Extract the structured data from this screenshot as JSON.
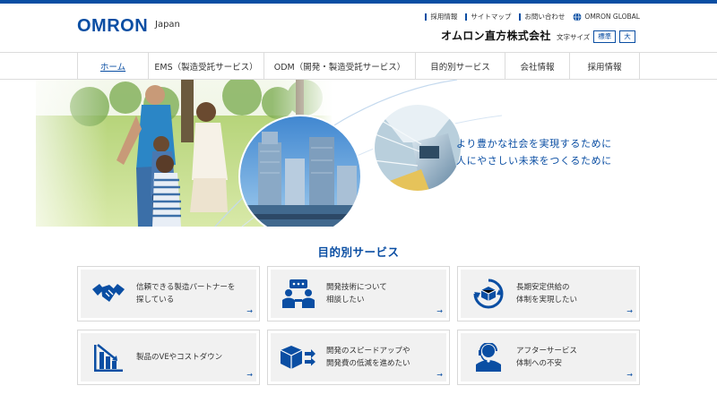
{
  "header": {
    "logo": "OMRON",
    "region": "Japan",
    "links": [
      "採用情報",
      "サイトマップ",
      "お問い合わせ"
    ],
    "global_link": "OMRON GLOBAL",
    "company_name": "オムロン直方株式会社",
    "font_size_label": "文字サイズ",
    "font_sizes": [
      "標準",
      "大"
    ]
  },
  "nav": {
    "items": [
      "ホーム",
      "EMS（製造受託サービス）",
      "ODM（開発・製造受託サービス）",
      "目的別サービス",
      "会社情報",
      "採用情報"
    ]
  },
  "hero": {
    "tagline_line1": "より豊かな社会を実現するために",
    "tagline_line2": "人にやさしい未来をつくるために"
  },
  "services": {
    "title": "目的別サービス",
    "cards": [
      {
        "line1": "信頼できる製造パートナーを",
        "line2": "探している",
        "icon": "handshake-icon"
      },
      {
        "line1": "開発技術について",
        "line2": "相談したい",
        "icon": "consultation-icon"
      },
      {
        "line1": "長期安定供給の",
        "line2": "体制を実現したい",
        "icon": "supply-cycle-icon"
      },
      {
        "line1": "製品のVEやコストダウン",
        "line2": "",
        "icon": "cost-down-chart-icon"
      },
      {
        "line1": "開発のスピードアップや",
        "line2": "開発費の低減を進めたい",
        "icon": "speed-box-icon"
      },
      {
        "line1": "アフターサービス",
        "line2": "体制への不安",
        "icon": "support-operator-icon"
      }
    ],
    "arrow": "→"
  },
  "colors": {
    "brand": "#0a4ea3",
    "card_bg": "#f1f1f1"
  }
}
